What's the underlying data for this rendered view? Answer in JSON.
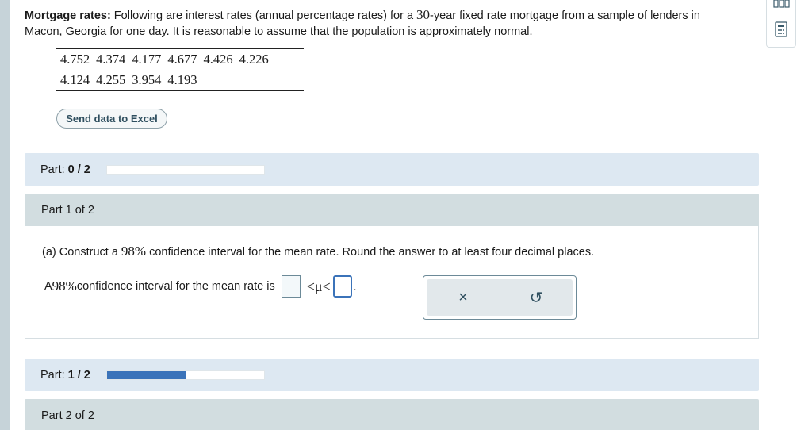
{
  "problem": {
    "title": "Mortgage rates:",
    "text_before_num": " Following are interest rates (annual percentage rates) for a ",
    "num": "30",
    "text_after_num": "-year fixed rate mortgage from a sample of lenders in Macon, Georgia for one day. It is reasonable to assume that the population is approximately normal."
  },
  "data_table": {
    "rows": [
      [
        "4.752",
        "4.374",
        "4.177",
        "4.677",
        "4.426",
        "4.226"
      ],
      [
        "4.124",
        "4.255",
        "3.954",
        "4.193"
      ]
    ]
  },
  "excel_button_label": "Send data to Excel",
  "progress_part1": {
    "label": "Part:",
    "value": "0 / 2",
    "fraction": 0.0
  },
  "part1": {
    "header": "Part 1 of 2",
    "question_prefix": "(a) Construct a ",
    "question_pct": "98%",
    "question_suffix": " confidence interval for the mean rate. Round the answer to at least four decimal places.",
    "answer_prefix": "A ",
    "answer_pct": "98%",
    "answer_suffix": " confidence interval for the mean rate is",
    "inequality_symbol": "<μ<",
    "period": "."
  },
  "tools": {
    "clear_symbol": "×",
    "undo_symbol": "↺"
  },
  "progress_part2": {
    "label": "Part:",
    "value": "1 / 2",
    "fraction": 0.5
  },
  "part2": {
    "header": "Part 2 of 2"
  },
  "side_icons": {
    "top": "grid-icon",
    "bottom": "calculator-icon"
  },
  "colors": {
    "accent": "#3b73b9",
    "part_bar_bg": "#dde8f2",
    "part_header_bg": "#d2dde0"
  }
}
